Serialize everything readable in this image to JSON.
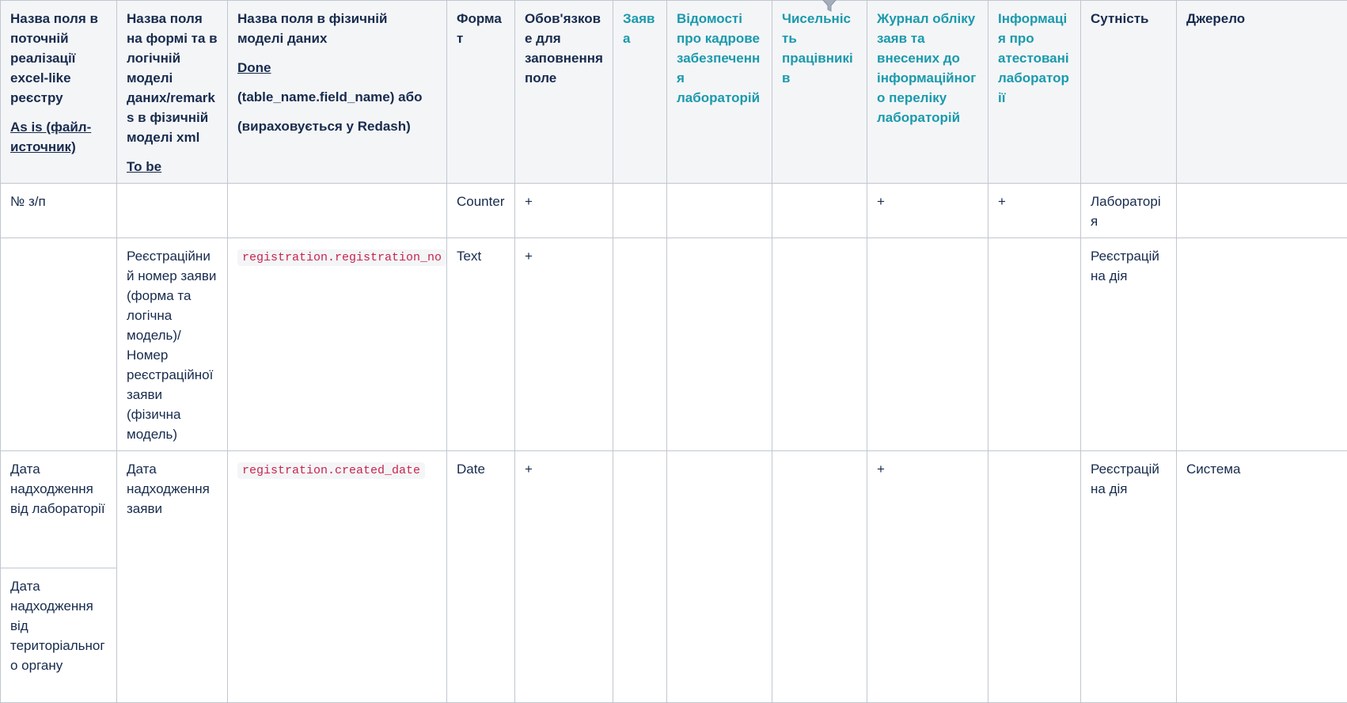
{
  "header": {
    "col1": {
      "title": "Назва поля в поточній реалізації excel-like реєстру",
      "subtitle": "As is (файл-источник)"
    },
    "col2": {
      "title": "Назва поля на формі та в логічній моделі даних/remarks в фізичній моделі xml",
      "subtitle": "To be"
    },
    "col3": {
      "title": "Назва поля в фізичній моделі даних",
      "subtitle": "Done",
      "line3": "(table_name.field_name) або",
      "line4": "(вираховується у Redash)"
    },
    "col4": "Формат",
    "col5": "Обов'язкове для заповнення поле",
    "col6": "Заява",
    "col7": "Відомості про кадрове забезпечення лабораторій",
    "col8": "Чисельність працівників",
    "col9": "Журнал обліку заяв та внесених до інформаційного переліку лабораторій",
    "col10": "Інформація про атестовані лабораторії",
    "col11": "Сутність",
    "col12": "Джерело"
  },
  "rows": [
    {
      "col1": "№ з/п",
      "col2": "",
      "col3": "",
      "format": "Counter",
      "required": "+",
      "zaiava": "",
      "kadry": "",
      "chyselnist": "",
      "zhurnal": "+",
      "info": "+",
      "entity": "Лабораторія",
      "source": ""
    },
    {
      "col1": "",
      "col2": "Реєстраційний номер заяви (форма та логічна модель)/Номер реєстраційної заяви (фізична модель)",
      "col3": "registration.registration_no",
      "format": "Text",
      "required": "+",
      "zaiava": "",
      "kadry": "",
      "chyselnist": "",
      "zhurnal": "",
      "info": "",
      "entity": "Реєстраційна дія",
      "source": ""
    },
    {
      "col1a": "Дата надходження від лабораторії",
      "col1b": "Дата надходження від територіального органу",
      "col2": "Дата надходження заяви",
      "col3": "registration.created_date",
      "format": "Date",
      "required": "+",
      "zaiava": "",
      "kadry": "",
      "chyselnist": "",
      "zhurnal": "+",
      "info": "",
      "entity": "Реєстраційна дія",
      "source": "Система"
    }
  ],
  "icons": {
    "filter": "filter-icon"
  },
  "colors": {
    "header_bg": "#f4f5f7",
    "teal_header": "#1a9aac",
    "code_text": "#c7254e",
    "border": "#c1c7d0"
  }
}
